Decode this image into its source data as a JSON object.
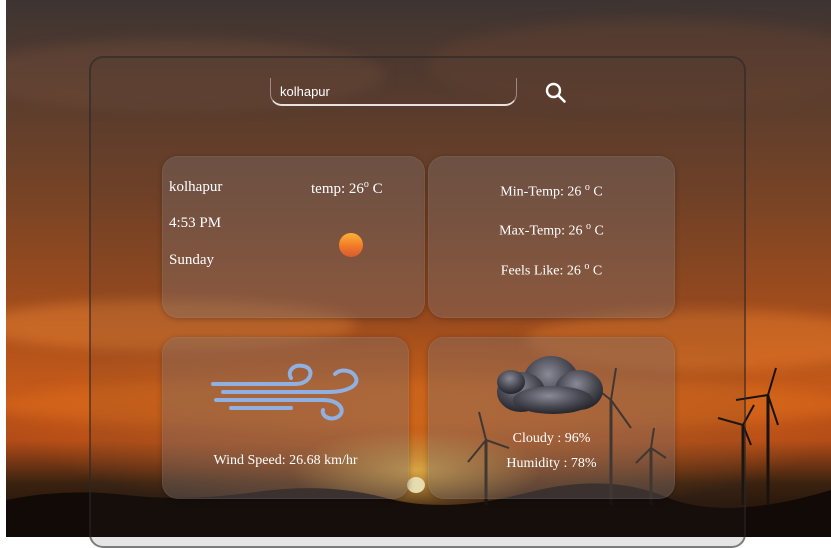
{
  "search": {
    "value": "kolhapur",
    "icon": "search-icon"
  },
  "current": {
    "city": "kolhapur",
    "temp_label": "temp: 26",
    "temp_unit": "C",
    "time": "4:53 PM",
    "day": "Sunday",
    "icon": "sun-icon"
  },
  "details": {
    "min_temp_label": "Min-Temp: 26",
    "max_temp_label": "Max-Temp: 26",
    "feels_like_label": "Feels Like: 26",
    "unit": "C"
  },
  "wind": {
    "label": "Wind Speed: 26.68 km/hr",
    "icon": "wind-icon"
  },
  "clouds": {
    "cloudy_label": "Cloudy : 96%",
    "humidity_label": "Humidity : 78%",
    "icon": "cloud-icon"
  },
  "colors": {
    "card_bg": "#7a6e6e",
    "text": "#ffffff",
    "wind_icon": "#8fb0e0",
    "sun_top": "#ffb13a",
    "sun_bottom": "#d85a30"
  }
}
